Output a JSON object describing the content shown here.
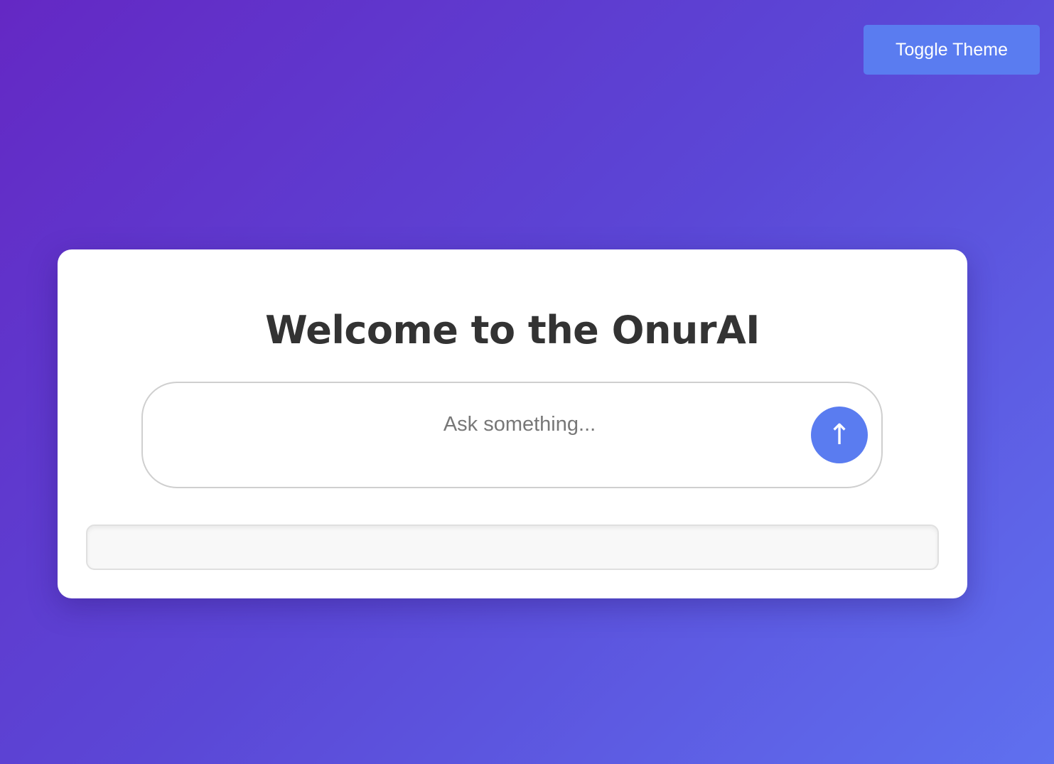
{
  "header": {
    "toggle_theme_label": "Toggle Theme"
  },
  "main": {
    "title": "Welcome to the OnurAI",
    "ask": {
      "placeholder": "Ask something...",
      "value": ""
    },
    "send_button": {
      "icon": "arrow-up-icon",
      "glyph": "↑"
    },
    "response": {
      "text": ""
    }
  },
  "colors": {
    "accent": "#5a7cf0",
    "title_text": "#333333",
    "background_start": "#6428c4",
    "background_end": "#5f70ef"
  }
}
